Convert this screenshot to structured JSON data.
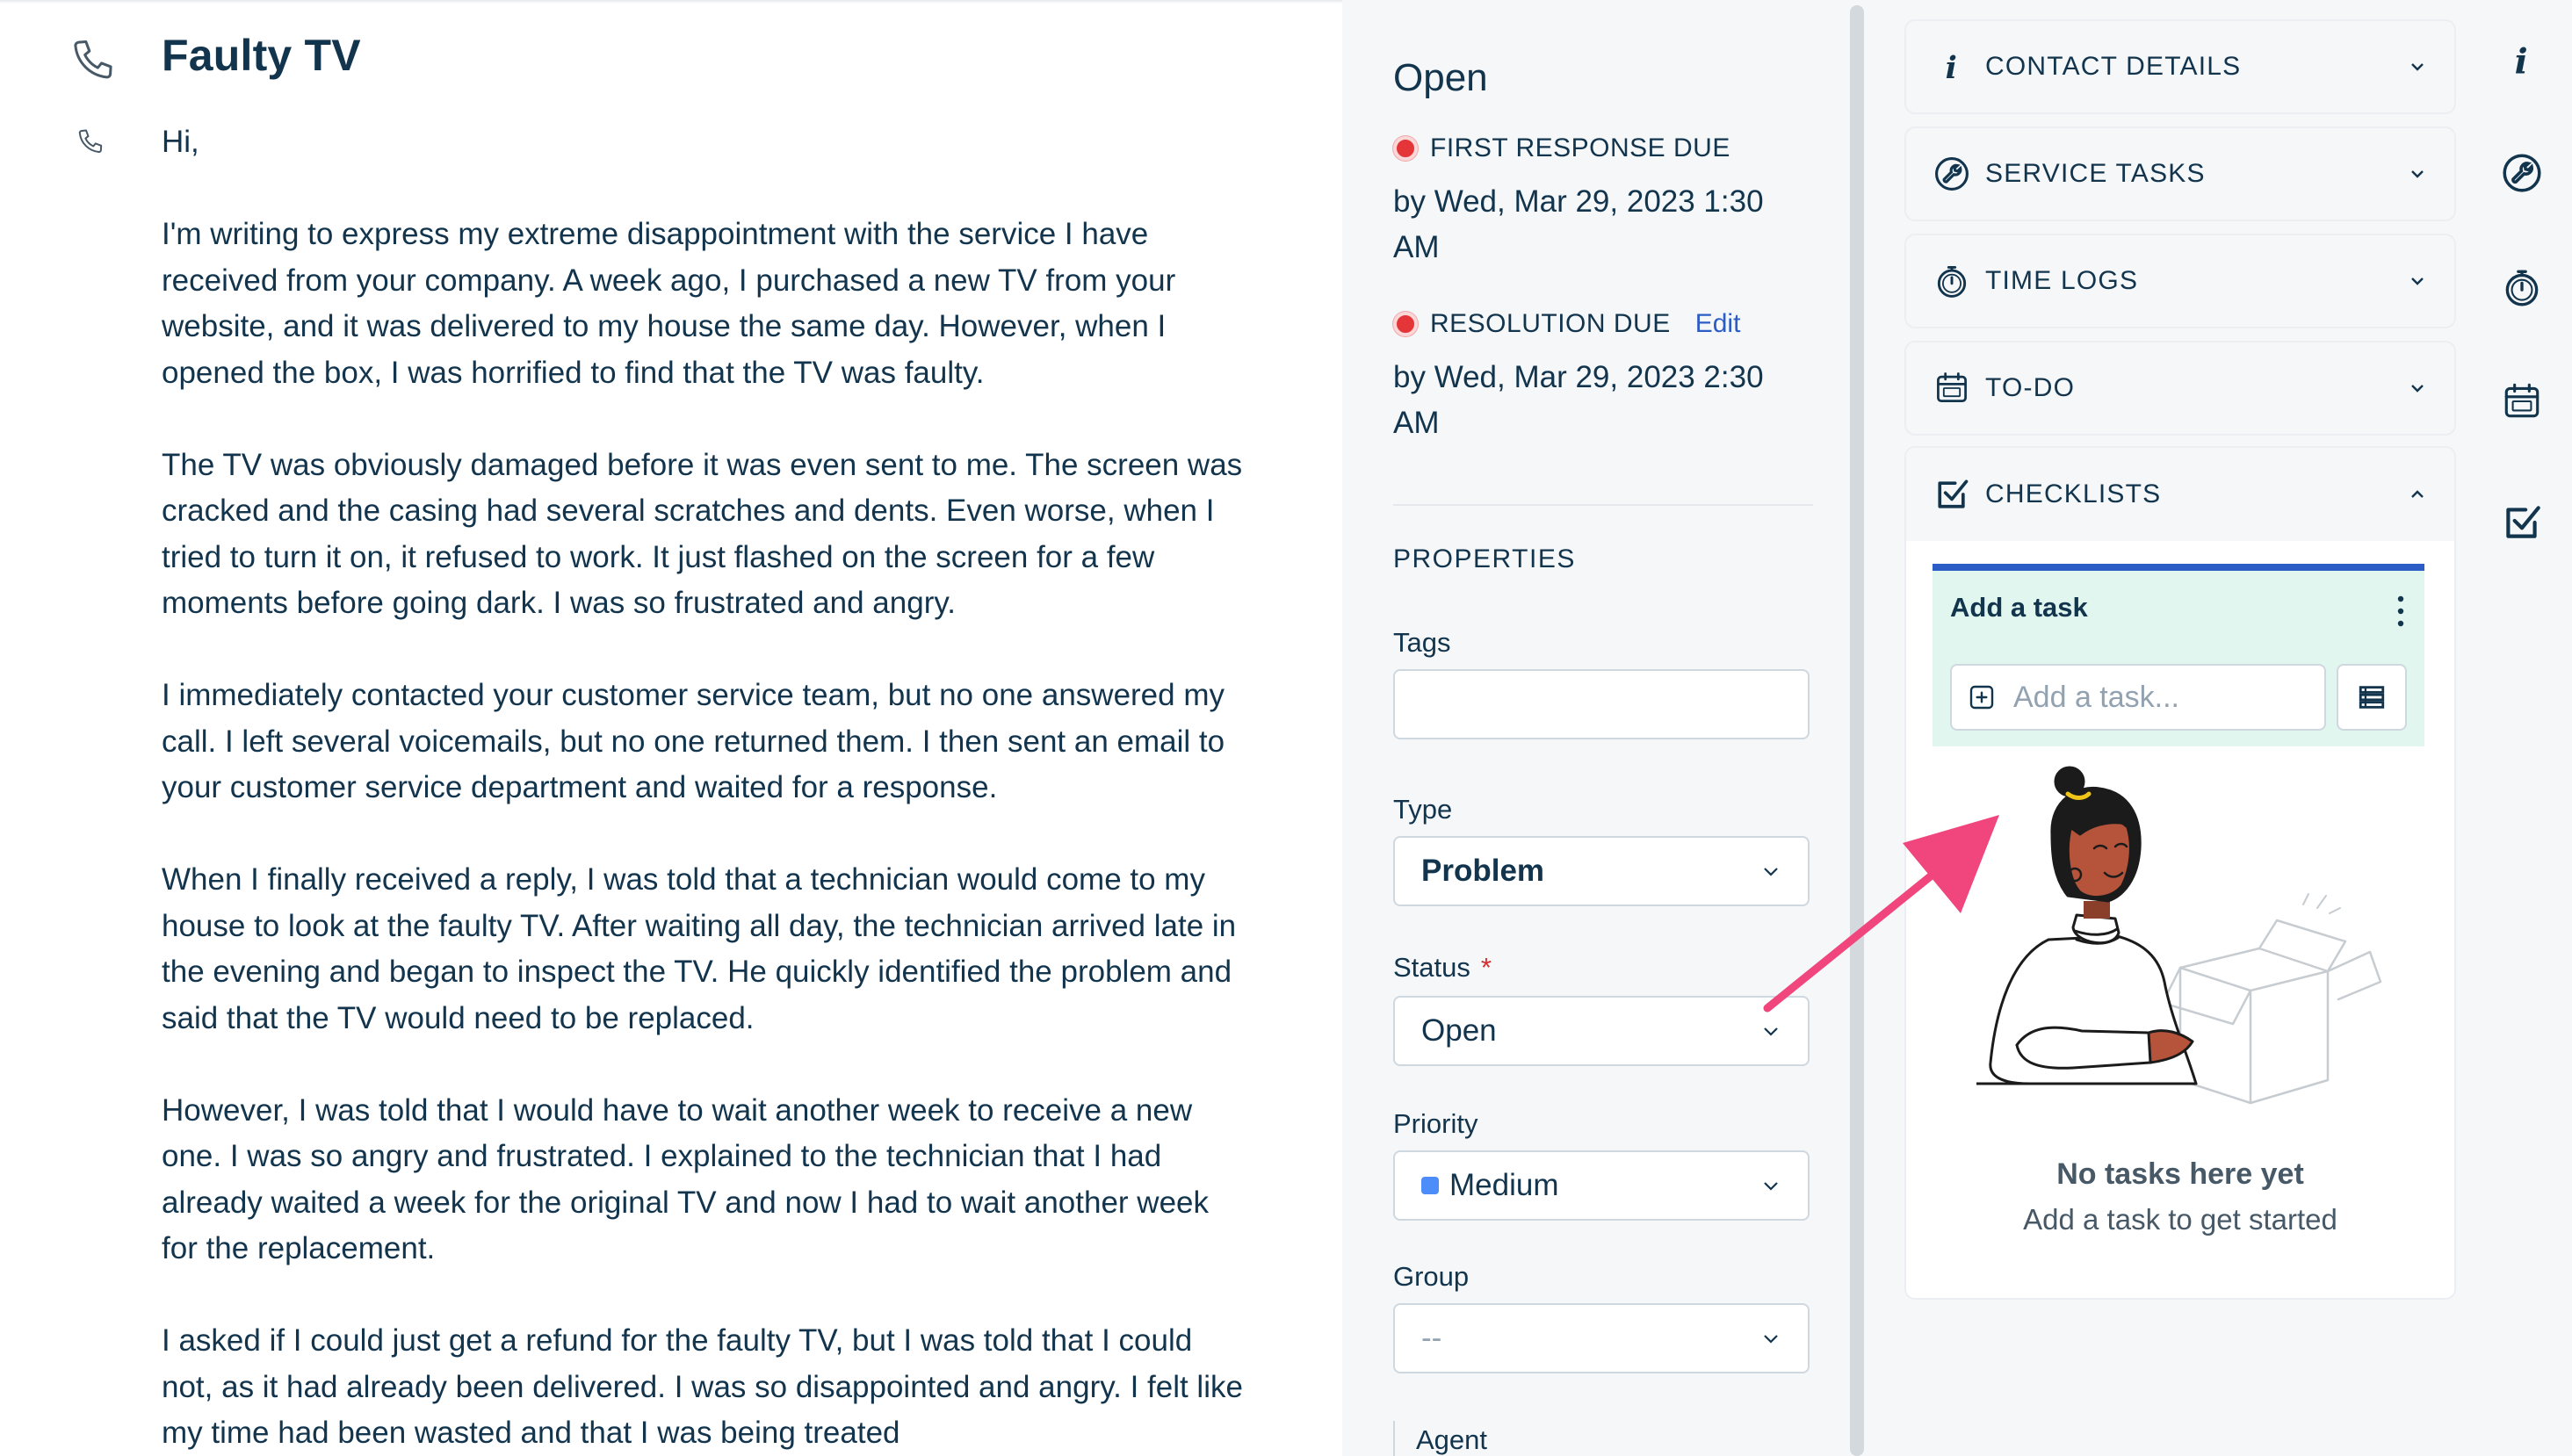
{
  "ticket": {
    "subject": "Faulty TV",
    "body": [
      "Hi,",
      "I'm writing to express my extreme disappointment with the service I have received from your company. A week ago, I purchased a new TV from your website, and it was delivered to my house the same day. However, when I opened the box, I was horrified to find that the TV was faulty.",
      "The TV was obviously damaged before it was even sent to me. The screen was cracked and the casing had several scratches and dents. Even worse, when I tried to turn it on, it refused to work. It just flashed on the screen for a few moments before going dark. I was so frustrated and angry.",
      "I immediately contacted your customer service team, but no one answered my call. I left several voicemails, but no one returned them. I then sent an email to your customer service department and waited for a response.",
      "When I finally received a reply, I was told that a technician would come to my house to look at the faulty TV. After waiting all day, the technician arrived late in the evening and began to inspect the TV. He quickly identified the problem and said that the TV would need to be replaced.",
      "However, I was told that I would have to wait another week to receive a new one. I was so angry and frustrated. I explained to the technician that I had already waited a week for the original TV and now I had to wait another week for the replacement.",
      "I asked if I could just get a refund for the faulty TV, but I was told that I could not, as it had already been delivered. I was so disappointed and angry. I felt like my time had been wasted and that I was being treated"
    ]
  },
  "properties_panel": {
    "status_title": "Open",
    "first_response_label": "FIRST RESPONSE DUE",
    "first_response_time": "by Wed, Mar 29, 2023 1:30 AM",
    "resolution_label": "RESOLUTION DUE",
    "resolution_edit": "Edit",
    "resolution_time": "by Wed, Mar 29, 2023 2:30 AM",
    "section_title": "PROPERTIES",
    "tags_label": "Tags",
    "tags_value": "",
    "type_label": "Type",
    "type_value": "Problem",
    "status_label": "Status",
    "status_required": "*",
    "status_value": "Open",
    "priority_label": "Priority",
    "priority_value": "Medium",
    "group_label": "Group",
    "group_value": "--",
    "agent_label": "Agent"
  },
  "widgets": {
    "contact_details": "CONTACT DETAILS",
    "service_tasks": "SERVICE TASKS",
    "time_logs": "TIME LOGS",
    "todo": "TO-DO",
    "checklists": "CHECKLISTS",
    "checklist": {
      "title": "Add a task",
      "input_placeholder": "Add a task...",
      "empty_title": "No tasks here yet",
      "empty_subtitle": "Add a task to get started"
    }
  },
  "colors": {
    "text": "#12344d",
    "link": "#2c5cc5",
    "sla_overdue": "#e43538",
    "priority_medium": "#4d8dfa",
    "checklist_bg": "#e1f6ee",
    "checklist_accent": "#2c5cc5",
    "annotation_arrow": "#f0457d"
  },
  "icons": {
    "channel": "phone-icon",
    "contact_details": "info-icon",
    "service_tasks": "wrench-icon",
    "time_logs": "stopwatch-icon",
    "todo": "calendar-icon",
    "checklists": "checkbox-icon"
  }
}
